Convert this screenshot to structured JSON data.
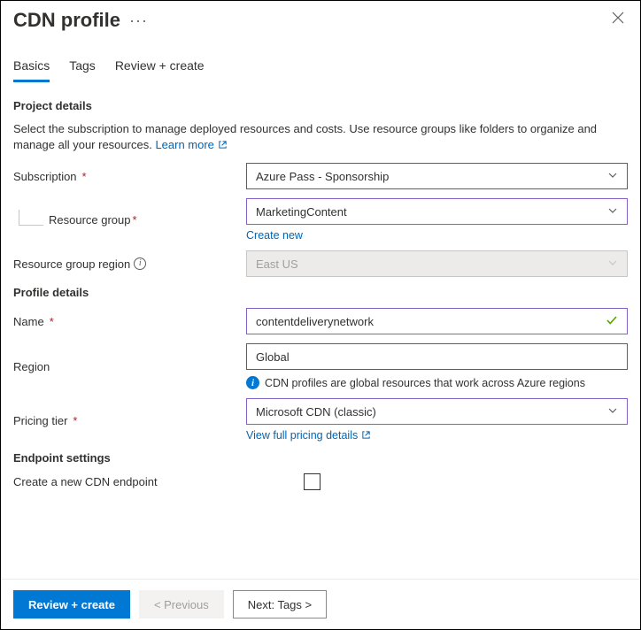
{
  "header": {
    "title": "CDN profile"
  },
  "tabs": {
    "basics": "Basics",
    "tags": "Tags",
    "review": "Review + create"
  },
  "project": {
    "title": "Project details",
    "desc": "Select the subscription to manage deployed resources and costs. Use resource groups like folders to organize and manage all your resources.",
    "learn_more": "Learn more"
  },
  "subscription": {
    "label": "Subscription",
    "value": "Azure Pass - Sponsorship"
  },
  "resource_group": {
    "label": "Resource group",
    "value": "MarketingContent",
    "create_new": "Create new"
  },
  "rg_region": {
    "label": "Resource group region",
    "value": "East US"
  },
  "profile": {
    "title": "Profile details"
  },
  "name": {
    "label": "Name",
    "value": "contentdeliverynetwork"
  },
  "region": {
    "label": "Region",
    "value": "Global",
    "helper": "CDN profiles are global resources that work across Azure regions"
  },
  "pricing": {
    "label": "Pricing tier",
    "value": "Microsoft CDN (classic)",
    "link": "View full pricing details"
  },
  "endpoint": {
    "title": "Endpoint settings",
    "label": "Create a new CDN endpoint"
  },
  "footer": {
    "review": "Review + create",
    "prev": "< Previous",
    "next": "Next: Tags >"
  }
}
